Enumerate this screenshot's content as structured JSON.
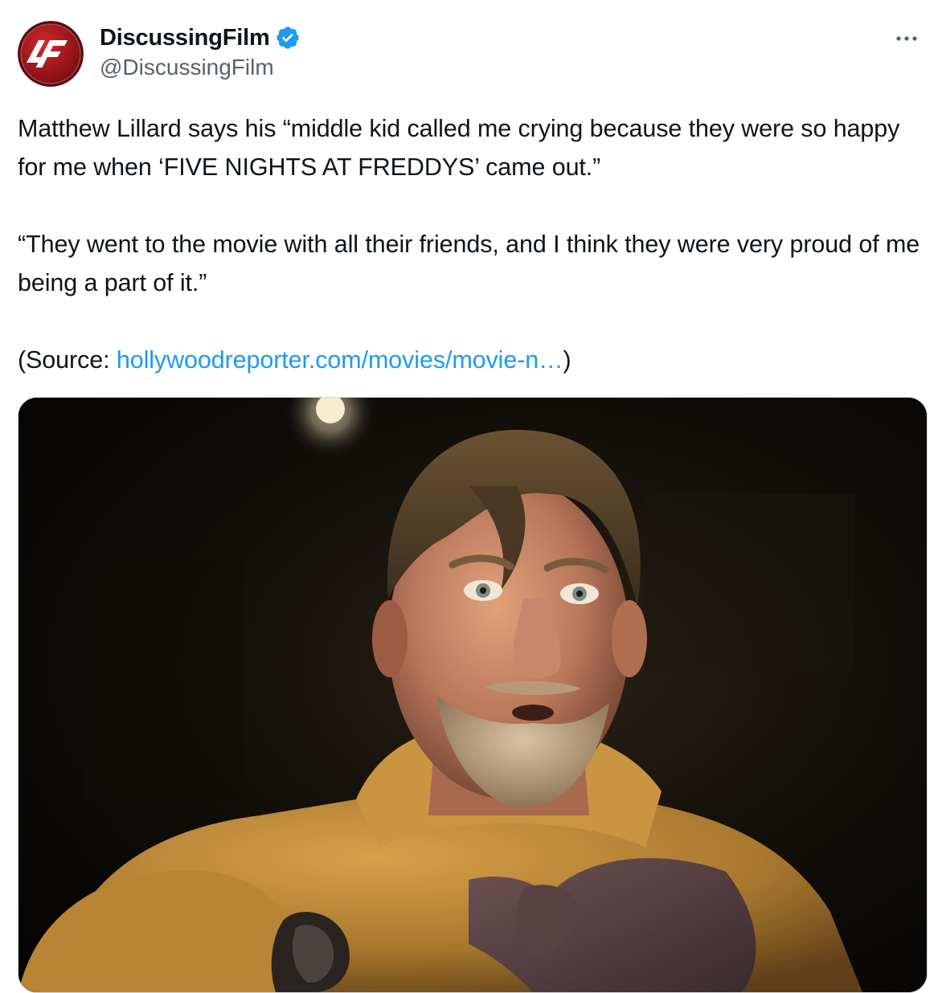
{
  "author": {
    "display_name": "DiscussingFilm",
    "handle": "@DiscussingFilm",
    "avatar_icon": "df-logo-icon",
    "verified_icon": "verified-badge-icon",
    "verified_color": "#1d9bf0",
    "avatar_color": "#b3161b"
  },
  "more_icon": "more-options-icon",
  "tweet": {
    "para1": "Matthew Lillard says his “middle kid called me crying because they were so happy for me when ‘FIVE NIGHTS AT FREDDYS’ came out.”",
    "para2": "“They went to the movie with all their friends, and I think they were very proud of me being a part of it.”",
    "source_prefix": "(Source: ",
    "source_link": "hollywoodreporter.com/movies/movie-n…",
    "source_suffix": ")",
    "link_color": "#1d9bf0"
  },
  "media": {
    "type": "photo"
  }
}
